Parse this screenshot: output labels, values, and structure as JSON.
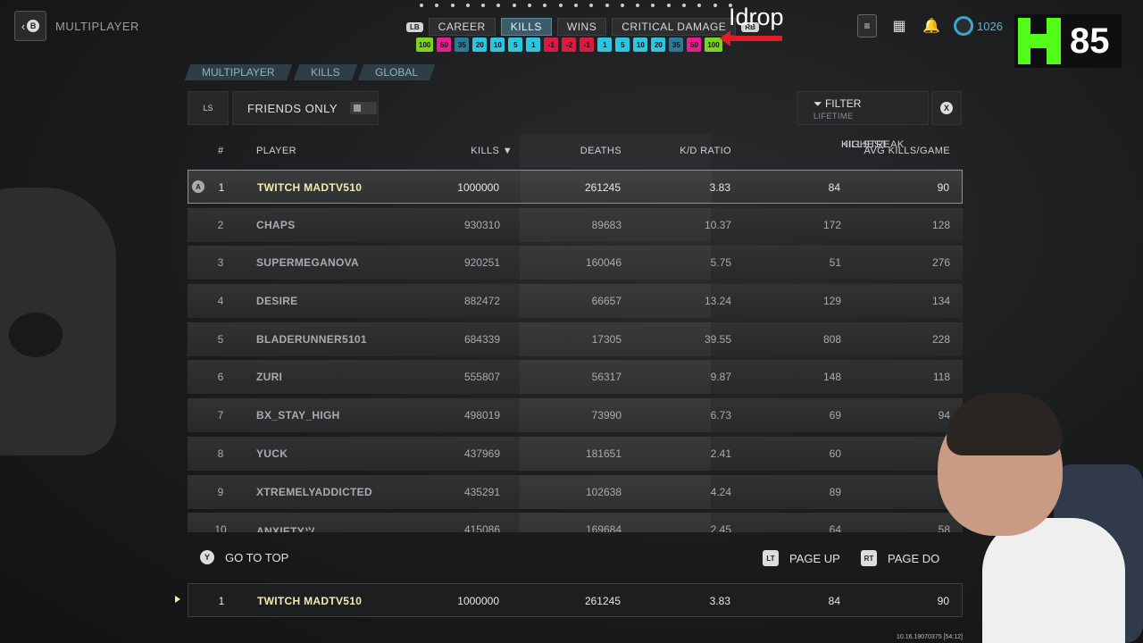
{
  "header": {
    "back_key": "B",
    "title": "MULTIPLAYER",
    "tab_left_key": "LB",
    "tab_right_key": "RB",
    "tabs": [
      {
        "label": "CAREER",
        "active": false
      },
      {
        "label": "KILLS",
        "active": true
      },
      {
        "label": "WINS",
        "active": false
      },
      {
        "label": "CRITICAL DAMAGE",
        "active": false
      }
    ],
    "points": "1026"
  },
  "chips": [
    {
      "label": "100",
      "color": "#7ed321"
    },
    {
      "label": "50",
      "color": "#e91e8c"
    },
    {
      "label": "35",
      "color": "#2a7a9a"
    },
    {
      "label": "20",
      "color": "#2ec5e0"
    },
    {
      "label": "10",
      "color": "#2ec5e0"
    },
    {
      "label": "5",
      "color": "#2ec5e0"
    },
    {
      "label": "1",
      "color": "#2ec5e0"
    },
    {
      "label": "-1",
      "color": "#d81b40"
    },
    {
      "label": "-2",
      "color": "#d81b40"
    },
    {
      "label": "-1",
      "color": "#d81b40"
    },
    {
      "label": "1",
      "color": "#2ec5e0"
    },
    {
      "label": "5",
      "color": "#2ec5e0"
    },
    {
      "label": "10",
      "color": "#2ec5e0"
    },
    {
      "label": "20",
      "color": "#2ec5e0"
    },
    {
      "label": "35",
      "color": "#2a7a9a"
    },
    {
      "label": "50",
      "color": "#e91e8c"
    },
    {
      "label": "100",
      "color": "#7ed321"
    }
  ],
  "overlay": {
    "idrop": "Idrop",
    "kick_count": "85",
    "timecode": "10.16.19070375 [54:12]"
  },
  "breadcrumbs": [
    "MULTIPLAYER",
    "KILLS",
    "GLOBAL"
  ],
  "controls": {
    "ls_key": "LS",
    "friends_label": "FRIENDS ONLY",
    "filter_label": "FILTER",
    "filter_sub": "LIFETIME",
    "close_key": "X"
  },
  "table": {
    "headers": {
      "rank": "#",
      "player": "PLAYER",
      "kills": "KILLS ▼",
      "deaths": "DEATHS",
      "kd": "K/D RATIO",
      "highest_line1": "HIGHEST",
      "highest_line2": "KILLSTREAK",
      "avg": "AVG KILLS/GAME"
    },
    "rows": [
      {
        "rank": "1",
        "name": "TWITCH MADTV510",
        "kills": "1000000",
        "deaths": "261245",
        "kd": "3.83",
        "hk": "84",
        "avg": "90"
      },
      {
        "rank": "2",
        "name": "CHAPS",
        "kills": "930310",
        "deaths": "89683",
        "kd": "10.37",
        "hk": "172",
        "avg": "128"
      },
      {
        "rank": "3",
        "name": "SUPERMEGANOVA",
        "kills": "920251",
        "deaths": "160046",
        "kd": "5.75",
        "hk": "51",
        "avg": "276"
      },
      {
        "rank": "4",
        "name": "DESIRE",
        "kills": "882472",
        "deaths": "66657",
        "kd": "13.24",
        "hk": "129",
        "avg": "134"
      },
      {
        "rank": "5",
        "name": "BLADERUNNER5101",
        "kills": "684339",
        "deaths": "17305",
        "kd": "39.55",
        "hk": "808",
        "avg": "228"
      },
      {
        "rank": "6",
        "name": "ZURI",
        "kills": "555807",
        "deaths": "56317",
        "kd": "9.87",
        "hk": "148",
        "avg": "118"
      },
      {
        "rank": "7",
        "name": "BX_STAY_HIGH",
        "kills": "498019",
        "deaths": "73990",
        "kd": "6.73",
        "hk": "69",
        "avg": "94"
      },
      {
        "rank": "8",
        "name": "YUCK",
        "kills": "437969",
        "deaths": "181651",
        "kd": "2.41",
        "hk": "60",
        "avg": ""
      },
      {
        "rank": "9",
        "name": "XTREMELYADDICTED",
        "kills": "435291",
        "deaths": "102638",
        "kd": "4.24",
        "hk": "89",
        "avg": ""
      },
      {
        "rank": "10",
        "name": "ANXIETYツ",
        "kills": "415086",
        "deaths": "169684",
        "kd": "2.45",
        "hk": "64",
        "avg": "58"
      }
    ],
    "first_row_key": "A"
  },
  "footer": {
    "go_top_key": "Y",
    "go_top_label": "GO TO TOP",
    "page_up_key": "LT",
    "page_up_label": "PAGE UP",
    "page_down_key": "RT",
    "page_down_label": "PAGE DO"
  },
  "my_row": {
    "rank": "1",
    "name": "TWITCH MADTV510",
    "kills": "1000000",
    "deaths": "261245",
    "kd": "3.83",
    "hk": "84",
    "avg": "90"
  }
}
